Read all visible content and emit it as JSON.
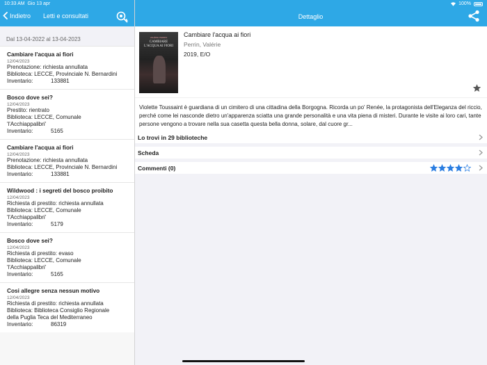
{
  "status_bar": {
    "time": "10:33 AM",
    "date": "Gio 13 apr",
    "battery": "100%"
  },
  "left_header": {
    "back_label": "Indietro",
    "title": "Letti e consultati"
  },
  "right_header": {
    "title": "Dettaglio"
  },
  "date_range": "Dal 13-04-2022 al 13-04-2023",
  "loans": [
    {
      "title": "Cambiare l'acqua ai fiori",
      "date": "12/04/2023",
      "lines": [
        "Prenotazione: richiesta annullata",
        "Biblioteca: LECCE, Provinciale N. Bernardini"
      ],
      "inventory_label": "Inventario:",
      "inventory": "133881"
    },
    {
      "title": "Bosco dove sei?",
      "date": "12/04/2023",
      "lines": [
        "Prestito: rientrato",
        "Biblioteca: LECCE, Comunale",
        "'l'Acchiappalibri'"
      ],
      "inventory_label": "Inventario:",
      "inventory": "5165"
    },
    {
      "title": "Cambiare l'acqua ai fiori",
      "date": "12/04/2023",
      "lines": [
        "Prenotazione: richiesta annullata",
        "Biblioteca: LECCE, Provinciale N. Bernardini"
      ],
      "inventory_label": "Inventario:",
      "inventory": "133881"
    },
    {
      "title": "Wildwood : i segreti del bosco proibito",
      "date": "12/04/2023",
      "lines": [
        "Richiesta di prestito: richiesta annullata",
        "Biblioteca: LECCE, Comunale",
        "'l'Acchiappalibri'"
      ],
      "inventory_label": "Inventario:",
      "inventory": "5179"
    },
    {
      "title": "Bosco dove sei?",
      "date": "12/04/2023",
      "lines": [
        "Richiesta di prestito: evaso",
        "Biblioteca: LECCE, Comunale",
        "'l'Acchiappalibri'"
      ],
      "inventory_label": "Inventario:",
      "inventory": "5165"
    },
    {
      "title": "Cosi allegre senza nessun motivo",
      "date": "12/04/2023",
      "lines": [
        "Richiesta di prestito: richiesta annullata",
        "Biblioteca: Biblioteca Consiglio Regionale",
        "della Puglia Teca del Mediterraneo"
      ],
      "inventory_label": "Inventario:",
      "inventory": "86319"
    }
  ],
  "book": {
    "title": "Cambiare l'acqua ai fiori",
    "author": "Perrin, Valérie",
    "year_publisher": "2019, E/O",
    "cover_author": "VALÉRIE PERRIN",
    "cover_title": "CAMBIARE L'ACQUA AI FIORI",
    "description": "Violette Toussaint è guardiana di un cimitero di una cittadina della Borgogna. Ricorda un po' Renée, la protagonista dell'Eleganza del riccio, perché come lei nasconde dietro un'apparenza sciatta una grande personalità e una vita piena di misteri. Durante le visite ai loro cari, tante persone vengono a trovare nella sua casetta questa bella donna, solare, dal cuore gr..."
  },
  "detail_rows": {
    "libraries": "Lo trovi in 29 biblioteche",
    "card": "Scheda",
    "comments": "Commenti (0)"
  },
  "rating": {
    "value": 4,
    "max": 5
  },
  "colors": {
    "accent": "#2ea8e6",
    "star": "#2a7de1"
  }
}
